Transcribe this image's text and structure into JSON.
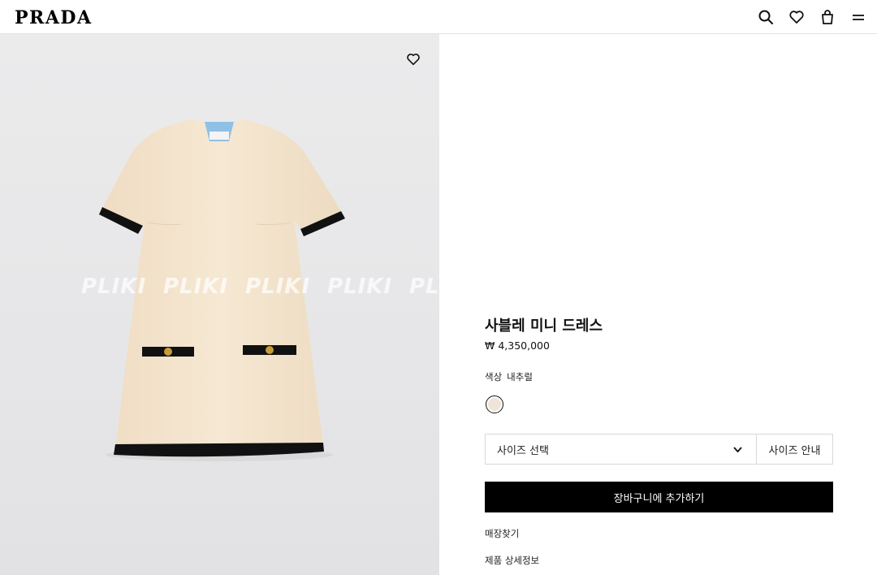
{
  "header": {
    "logo": "PRADA",
    "icons": [
      "search-icon",
      "heart-icon",
      "bag-icon",
      "menu-icon"
    ]
  },
  "gallery": {
    "watermark": [
      "PLIKI",
      "PLIKI",
      "PLIKI",
      "PLIKI",
      "PL"
    ],
    "wishlist_icon": "heart-icon"
  },
  "product": {
    "title": "사블레 미니 드레스",
    "price": "₩ 4,350,000",
    "color_label": "색상",
    "color_value": "내추럴",
    "swatch_color": "#efe4d8",
    "size_placeholder": "사이즈 선택",
    "size_guide": "사이즈 안내",
    "add_to_cart": "장바구니에 추가하기",
    "find_store": "매장찾기",
    "details": "제품 상세정보"
  },
  "colors": {
    "dress": "#f3e3cc",
    "trim": "#111111",
    "button_gold": "#c89a3a"
  }
}
